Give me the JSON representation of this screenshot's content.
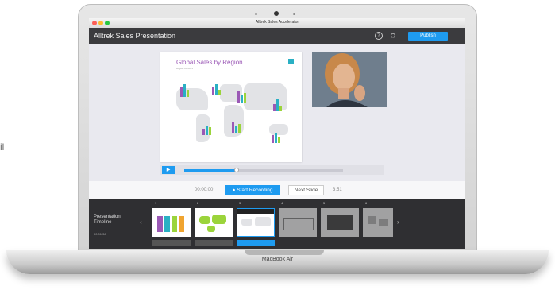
{
  "page_edge_text": "il",
  "device": {
    "model_label": "MacBook Air"
  },
  "window": {
    "title": "Alltrek Sales Accelerator"
  },
  "header": {
    "presentation_name": "Alltrek Sales Presentation",
    "help_icon": "?",
    "settings_icon": "⛭",
    "publish_label": "Publish"
  },
  "slide": {
    "title": "Global Sales by Region",
    "subtitle": "August 06 2015"
  },
  "player": {
    "play_icon": "▶",
    "progress": 0.33
  },
  "recording": {
    "elapsed": "00:00:00",
    "start_label": "Start Recording",
    "next_label": "Next Slide",
    "total": "3:51"
  },
  "timeline": {
    "label": "Presentation Timeline",
    "time": "00:01:36",
    "slide_numbers": [
      "1",
      "2",
      "3",
      "4",
      "5",
      "6"
    ],
    "prev_icon": "‹",
    "next_icon": "›"
  },
  "colors": {
    "accent": "#1e9bf0",
    "header_bg": "#3b3b3e",
    "timeline_bg": "#2f2f32"
  }
}
